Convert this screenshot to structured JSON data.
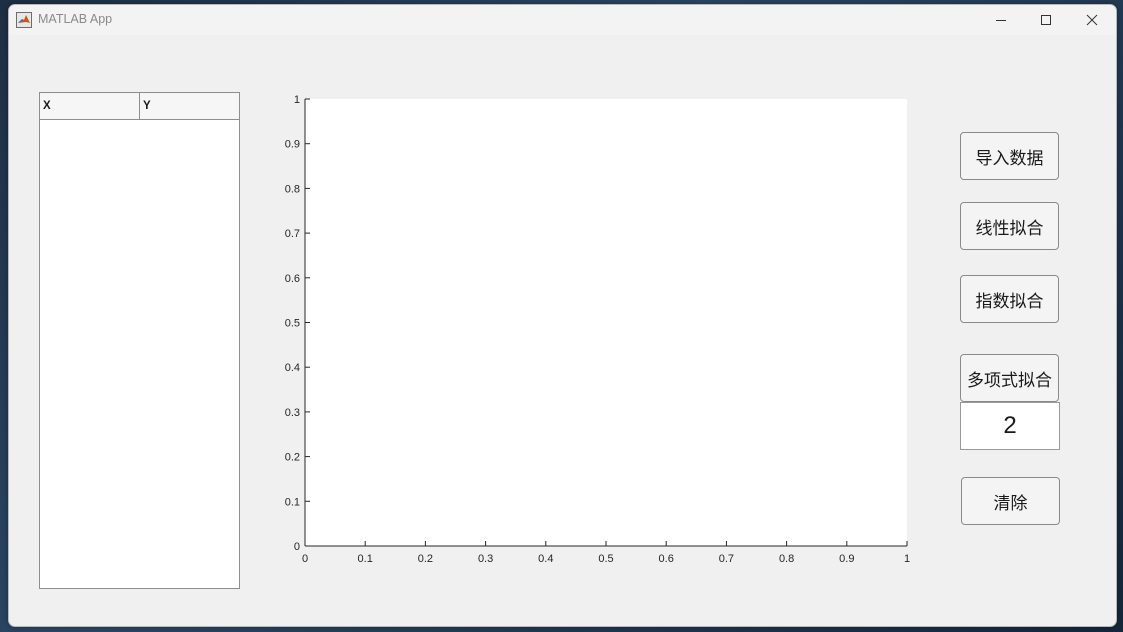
{
  "window": {
    "title": "MATLAB App"
  },
  "table": {
    "columns": [
      "X",
      "Y"
    ],
    "rows": []
  },
  "buttons": {
    "import": "导入数据",
    "linear": "线性拟合",
    "exponential": "指数拟合",
    "polynomial": "多项式拟合",
    "clear": "清除"
  },
  "polynomial_degree": "2",
  "chart_data": {
    "type": "line",
    "series": [],
    "xlim": [
      0,
      1
    ],
    "ylim": [
      0,
      1
    ],
    "x_ticks": [
      "0",
      "0.1",
      "0.2",
      "0.3",
      "0.4",
      "0.5",
      "0.6",
      "0.7",
      "0.8",
      "0.9",
      "1"
    ],
    "y_ticks": [
      "0",
      "0.1",
      "0.2",
      "0.3",
      "0.4",
      "0.5",
      "0.6",
      "0.7",
      "0.8",
      "0.9",
      "1"
    ],
    "title": "",
    "xlabel": "",
    "ylabel": "",
    "grid": false
  }
}
